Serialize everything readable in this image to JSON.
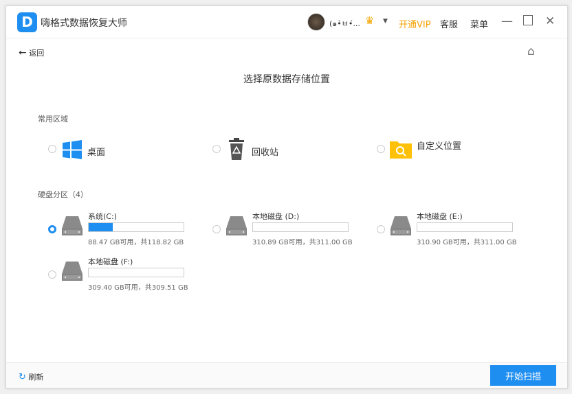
{
  "app": {
    "title": "嗨格式数据恢复大师",
    "logo_letter": "D"
  },
  "header": {
    "username": "(๑•̀ㅂ•́...",
    "vip": "开通VIP",
    "service": "客服",
    "menu": "菜单"
  },
  "nav": {
    "back": "返回"
  },
  "page_title": "选择原数据存储位置",
  "common": {
    "heading": "常用区域",
    "items": [
      {
        "label": "桌面"
      },
      {
        "label": "回收站"
      },
      {
        "label": "自定义位置"
      }
    ]
  },
  "disks": {
    "heading": "硬盘分区（4）",
    "items": [
      {
        "name": "系统(C:)",
        "info": "88.47 GB可用，共118.82 GB",
        "used_percent": 25.5,
        "selected": true
      },
      {
        "name": "本地磁盘 (D:)",
        "info": "310.89 GB可用，共311.00 GB",
        "used_percent": 0.04,
        "selected": false
      },
      {
        "name": "本地磁盘 (E:)",
        "info": "310.90 GB可用，共311.00 GB",
        "used_percent": 0.03,
        "selected": false
      },
      {
        "name": "本地磁盘 (F:)",
        "info": "309.40 GB可用，共309.51 GB",
        "used_percent": 0.04,
        "selected": false
      }
    ]
  },
  "footer": {
    "refresh": "刷新",
    "scan": "开始扫描"
  },
  "colors": {
    "accent": "#1e8ef0",
    "vip": "#f5a000"
  }
}
